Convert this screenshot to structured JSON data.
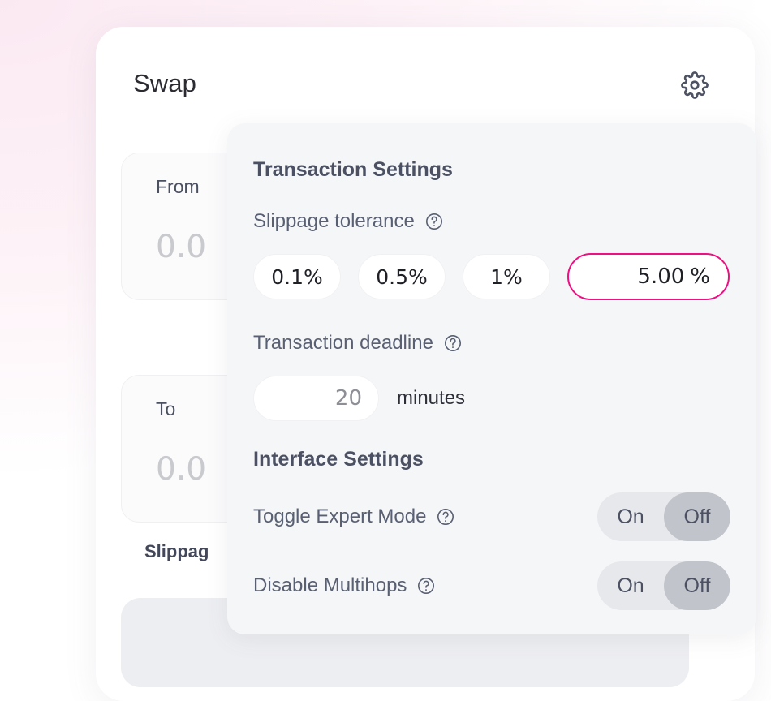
{
  "card": {
    "title": "Swap",
    "gear_icon": "gear-icon",
    "from": {
      "label": "From",
      "amount": "0.0"
    },
    "to": {
      "label": "To",
      "amount": "0.0"
    },
    "slippage_row_label": "Slippag",
    "action_button_label": ""
  },
  "settings": {
    "transaction_heading": "Transaction Settings",
    "slippage": {
      "label": "Slippage tolerance",
      "help_icon": "question-circle-icon",
      "options": [
        "0.1%",
        "0.5%",
        "1%"
      ],
      "custom_value": "5.00",
      "custom_suffix": "%",
      "custom_active": true,
      "accent_color": "#ef0f82"
    },
    "deadline": {
      "label": "Transaction deadline",
      "help_icon": "question-circle-icon",
      "value": "20",
      "unit": "minutes"
    },
    "interface_heading": "Interface Settings",
    "toggles": [
      {
        "name": "expert-mode",
        "label": "Toggle Expert Mode",
        "help_icon": "question-circle-icon",
        "on_label": "On",
        "off_label": "Off",
        "selected": "Off"
      },
      {
        "name": "multihops",
        "label": "Disable Multihops",
        "help_icon": "question-circle-icon",
        "on_label": "On",
        "off_label": "Off",
        "selected": "Off"
      }
    ]
  }
}
